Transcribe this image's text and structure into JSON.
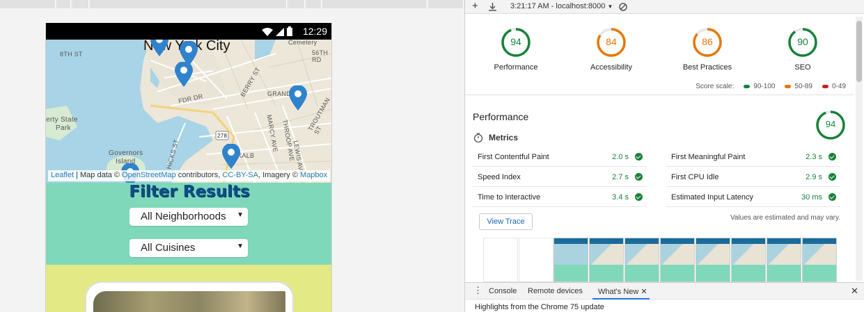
{
  "devtools": {
    "toolbar": {
      "timestamp": "3:21:17 AM - localhost:8000"
    },
    "gauges": [
      {
        "score": "94",
        "label": "Performance",
        "color": "#178239"
      },
      {
        "score": "84",
        "label": "Accessibility",
        "color": "#e67700"
      },
      {
        "score": "86",
        "label": "Best Practices",
        "color": "#e67700"
      },
      {
        "score": "90",
        "label": "SEO",
        "color": "#178239"
      }
    ],
    "scale": {
      "title": "Score scale:",
      "good": "90-100",
      "average": "50-89",
      "poor": "0-49",
      "good_color": "#178239",
      "average_color": "#e67700",
      "poor_color": "#c7221f"
    },
    "performance": {
      "title": "Performance",
      "score": "94",
      "metrics_title": "Metrics",
      "metrics": [
        {
          "name": "First Contentful Paint",
          "value": "2.0 s"
        },
        {
          "name": "First Meaningful Paint",
          "value": "2.3 s"
        },
        {
          "name": "Speed Index",
          "value": "2.7 s"
        },
        {
          "name": "First CPU Idle",
          "value": "2.9 s"
        },
        {
          "name": "Time to Interactive",
          "value": "3.4 s"
        },
        {
          "name": "Estimated Input Latency",
          "value": "30 ms"
        }
      ],
      "view_trace": "View Trace",
      "estimated_note": "Values are estimated and may vary."
    },
    "drawer": {
      "tabs": [
        "Console",
        "Remote devices",
        "What's New"
      ],
      "active_tab": "What's New",
      "content": "Highlights from the Chrome 75 update"
    }
  },
  "phone": {
    "status_time": "12:29",
    "map": {
      "city": "New York City",
      "labels": [
        "8TH ST",
        "Cemetery",
        "56TH RD",
        "BERRY ST",
        "GRAND ST",
        "FDR DR",
        "TROUTMAN ST",
        "erty State",
        "Park",
        "MARCY AVE",
        "THROOP AVE",
        "LEWIS AVE",
        "Governors",
        "Island",
        "HICKS ST",
        "DEKALB",
        "278"
      ],
      "attribution": {
        "leaflet": "Leaflet",
        "sep1": " | Map data © ",
        "osm": "OpenStreetMap",
        "contributors": " contributors, ",
        "license": "CC-BY-SA",
        "imagery": ", Imagery © ",
        "mapbox": "Mapbox"
      }
    },
    "filter": {
      "title": "Filter Results",
      "neighborhoods": "All Neighborhoods",
      "cuisines": "All Cuisines"
    }
  }
}
